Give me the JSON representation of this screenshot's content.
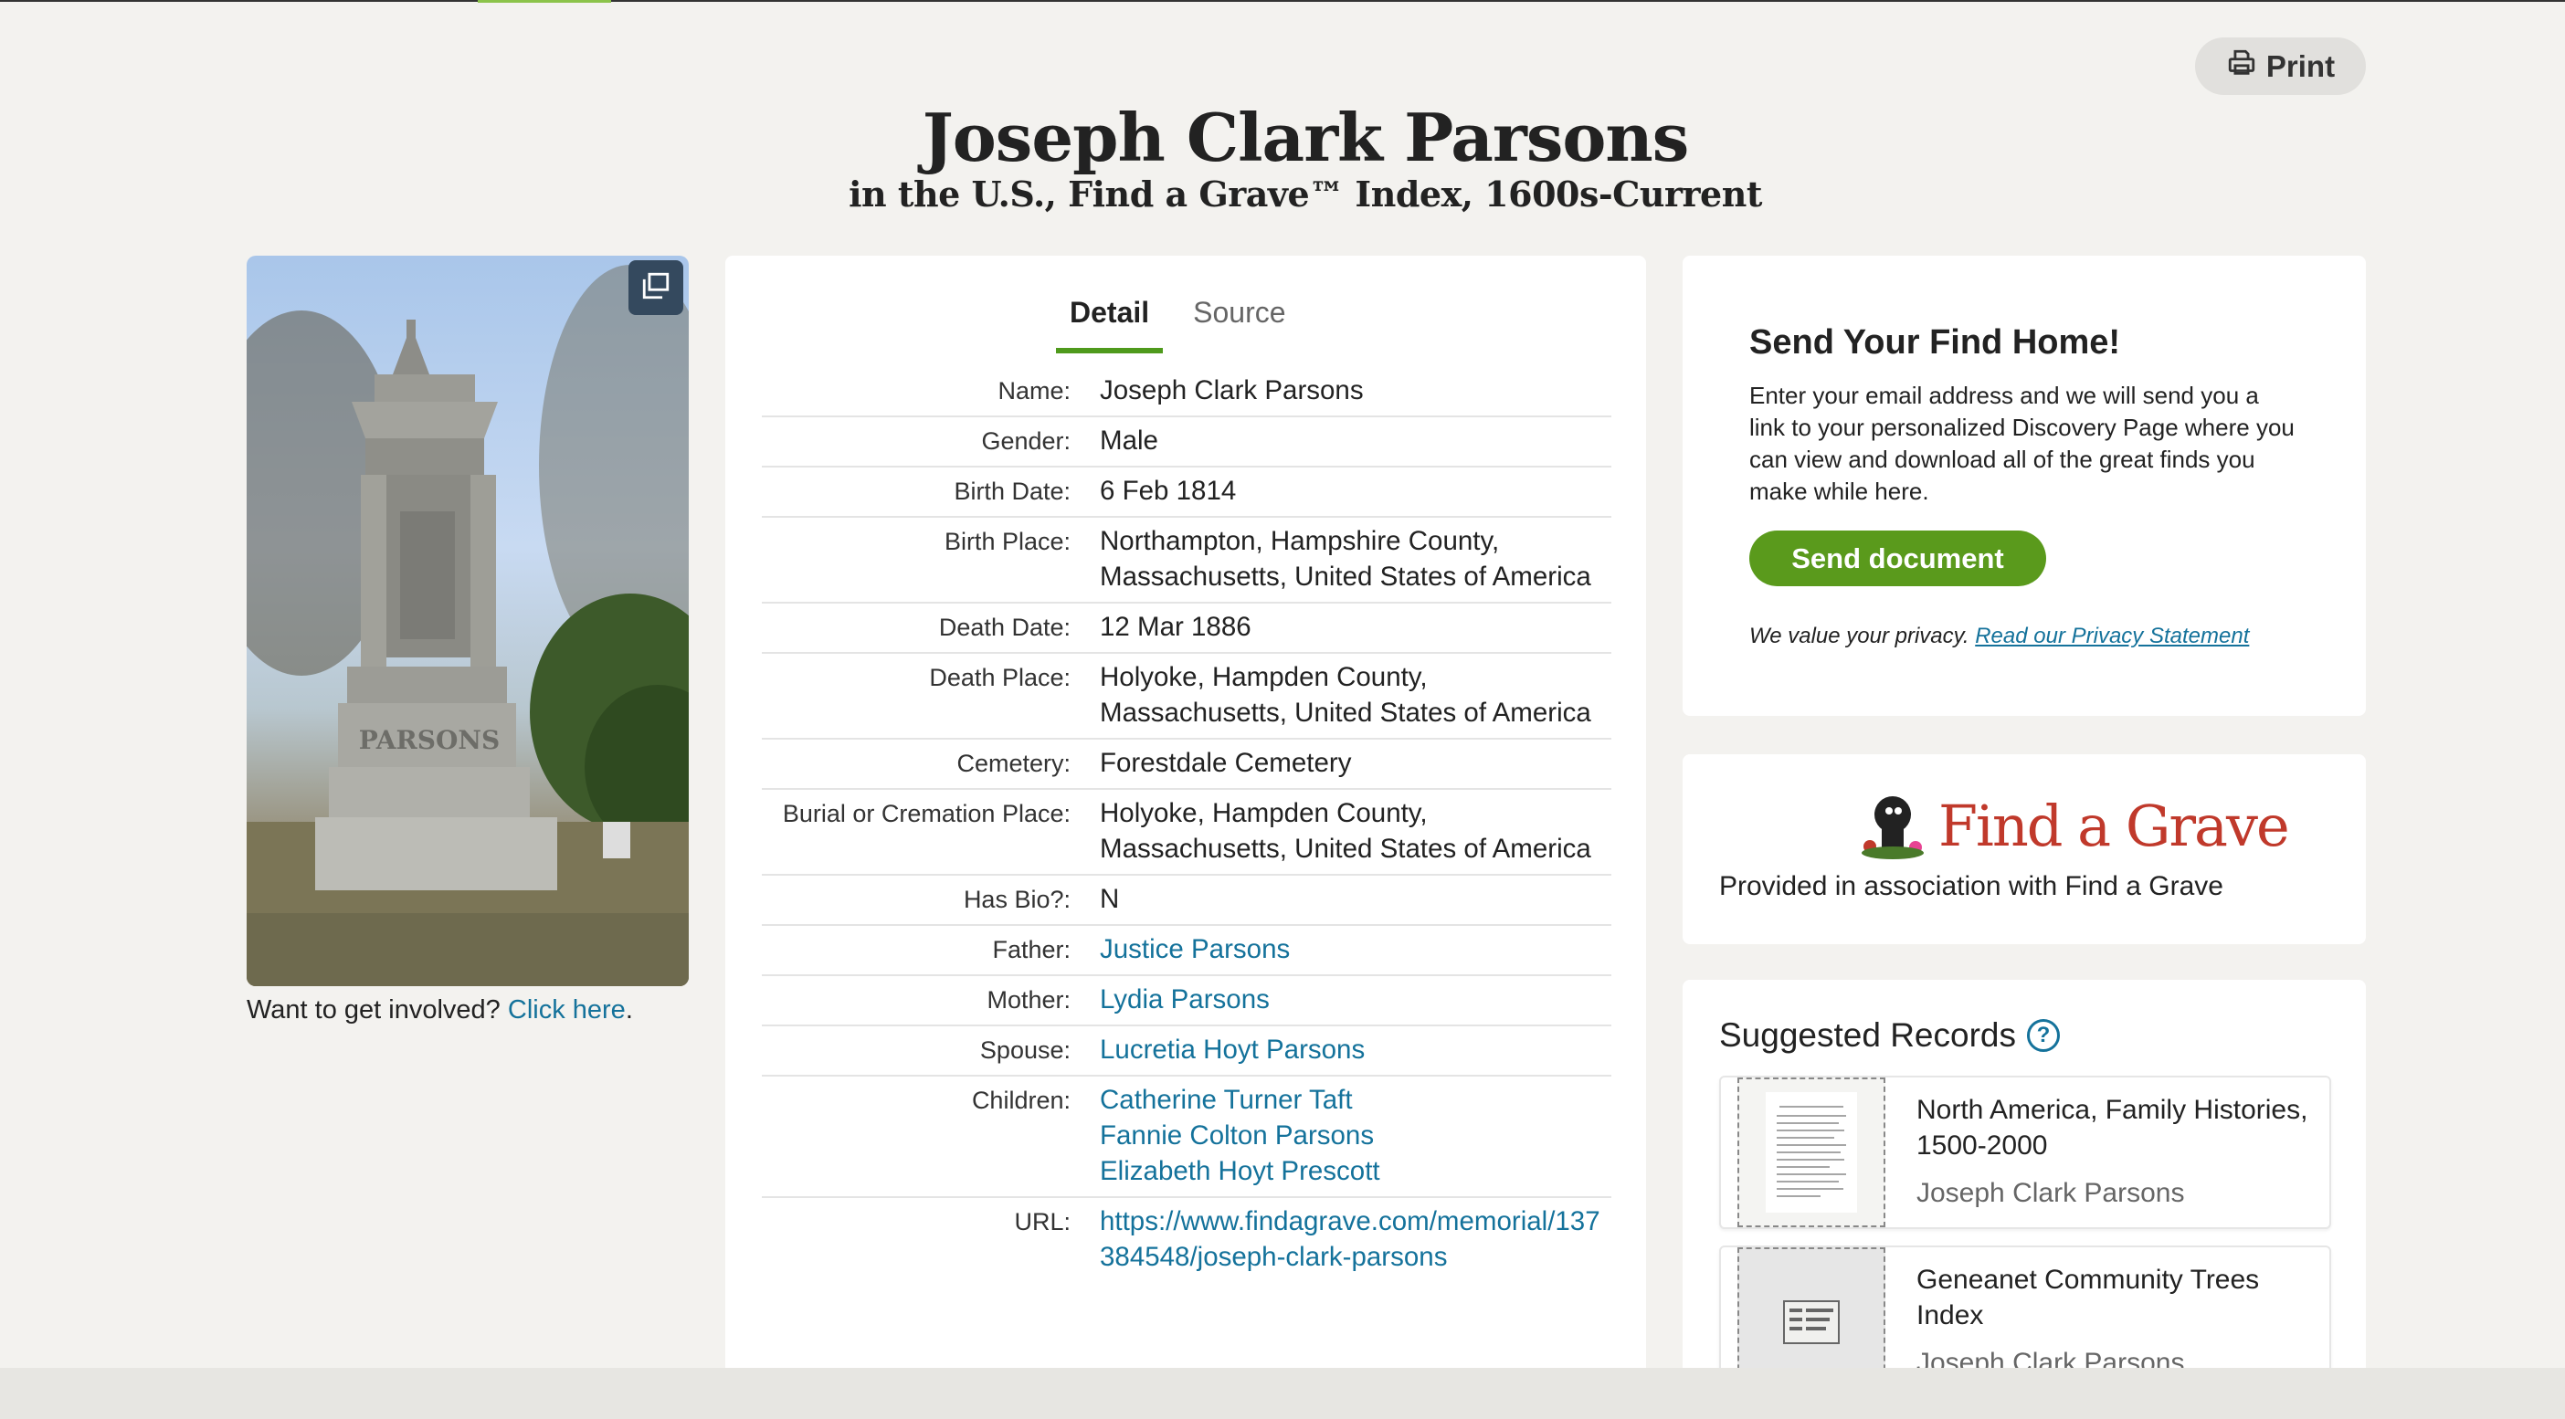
{
  "print_label": "Print",
  "header": {
    "title": "Joseph Clark Parsons",
    "subtitle": "in the U.S., Find a Grave™ Index, 1600s-Current"
  },
  "photo": {
    "involved_text": "Want to get involved?",
    "involved_link": "Click here",
    "involved_end": "."
  },
  "tabs": [
    {
      "label": "Detail",
      "active": true
    },
    {
      "label": "Source",
      "active": false
    }
  ],
  "details": {
    "name": {
      "label": "Name:",
      "value": "Joseph Clark Parsons"
    },
    "gender": {
      "label": "Gender:",
      "value": "Male"
    },
    "birth_date": {
      "label": "Birth Date:",
      "value": "6 Feb 1814"
    },
    "birth_place": {
      "label": "Birth Place:",
      "value": "Northampton, Hampshire County, Massachusetts, United States of America"
    },
    "death_date": {
      "label": "Death Date:",
      "value": "12 Mar 1886"
    },
    "death_place": {
      "label": "Death Place:",
      "value": "Holyoke, Hampden County, Massachusetts, United States of America"
    },
    "cemetery": {
      "label": "Cemetery:",
      "value": "Forestdale Cemetery"
    },
    "burial_place": {
      "label": "Burial or Cremation Place:",
      "value": "Holyoke, Hampden County, Massachusetts, United States of America"
    },
    "has_bio": {
      "label": "Has Bio?:",
      "value": "N"
    },
    "father": {
      "label": "Father:",
      "value": "Justice Parsons"
    },
    "mother": {
      "label": "Mother:",
      "value": "Lydia Parsons"
    },
    "spouse": {
      "label": "Spouse:",
      "value": "Lucretia Hoyt Parsons"
    },
    "children": {
      "label": "Children:",
      "values": [
        "Catherine Turner Taft",
        "Fannie Colton Parsons",
        "Elizabeth Hoyt Prescott"
      ]
    },
    "url": {
      "label": "URL:",
      "value": "https://www.findagrave.com/memorial/137384548/joseph-clark-parsons"
    }
  },
  "send_home": {
    "title": "Send Your Find Home!",
    "description": "Enter your email address and we will send you a link to your personalized Discovery Page where you can view and download all of the great finds you make while here.",
    "button": "Send document",
    "privacy_text": "We value your privacy.",
    "privacy_link": "Read our Privacy Statement"
  },
  "find_a_grave": {
    "logo_text": "Find a Grave",
    "caption": "Provided in association with Find a Grave"
  },
  "suggested": {
    "title": "Suggested Records",
    "records": [
      {
        "title": "North America, Family Histories, 1500-2000",
        "name": "Joseph Clark Parsons"
      },
      {
        "title": "Geneanet Community Trees Index",
        "name": "Joseph Clark Parsons"
      }
    ]
  },
  "colors": {
    "accent_green": "#5a9a1c",
    "link_blue": "#14729b",
    "logo_red": "#c0392b"
  }
}
